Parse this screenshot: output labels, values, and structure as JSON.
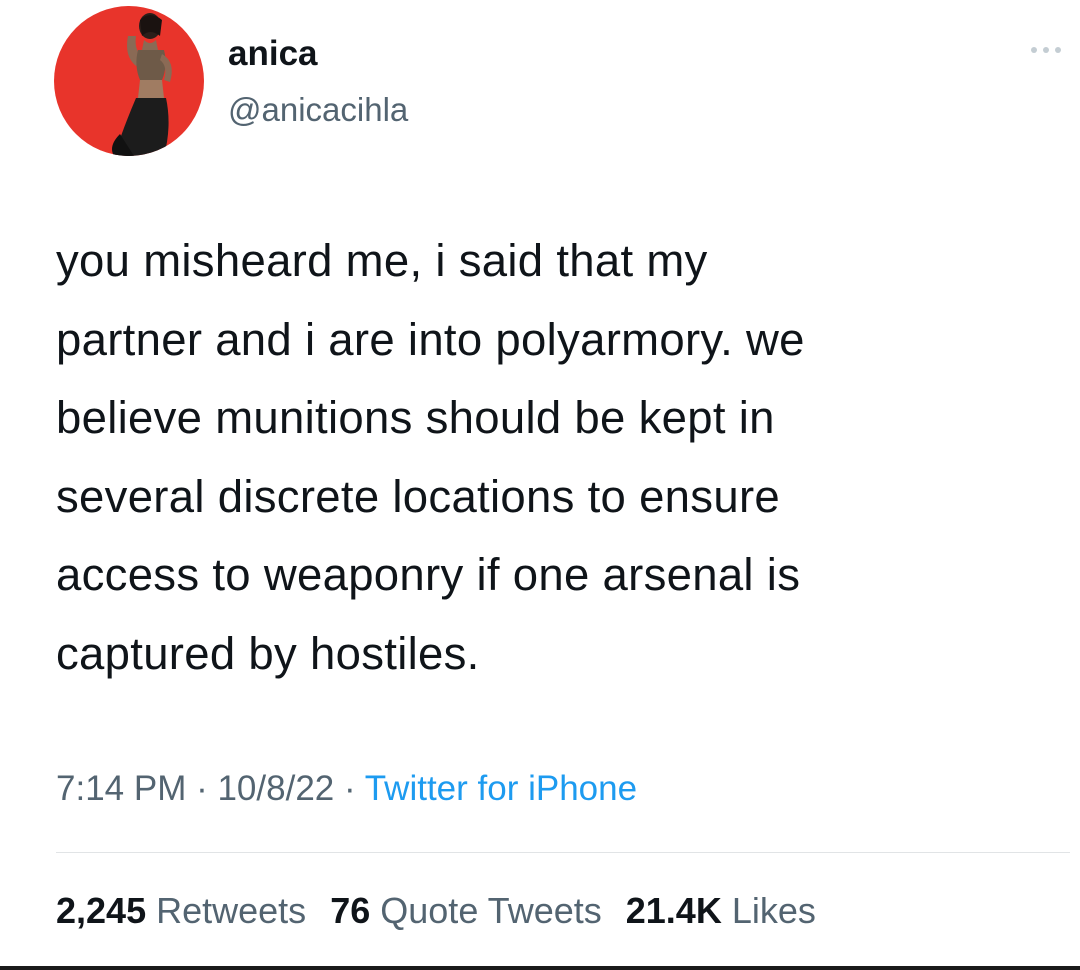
{
  "author": {
    "display_name": "anica",
    "handle": "@anicacihla",
    "avatar_bg": "#e8342b"
  },
  "more_icon": "more-horizontal-icon",
  "tweet": {
    "lines": [
      "you misheard me, i said that my",
      "partner and i are into polyarmory. we",
      "believe munitions should be kept in",
      "several discrete locations to ensure",
      "access to weaponry if one arsenal is",
      "captured by hostiles."
    ]
  },
  "meta": {
    "time": "7:14 PM",
    "separator": " · ",
    "date": "10/8/22",
    "source": "Twitter for iPhone",
    "source_color": "#1d9bf0"
  },
  "stats": {
    "retweets_count": "2,245",
    "retweets_label": "Retweets",
    "quotes_count": "76",
    "quotes_label": "Quote Tweets",
    "likes_count": "21.4K",
    "likes_label": "Likes"
  }
}
